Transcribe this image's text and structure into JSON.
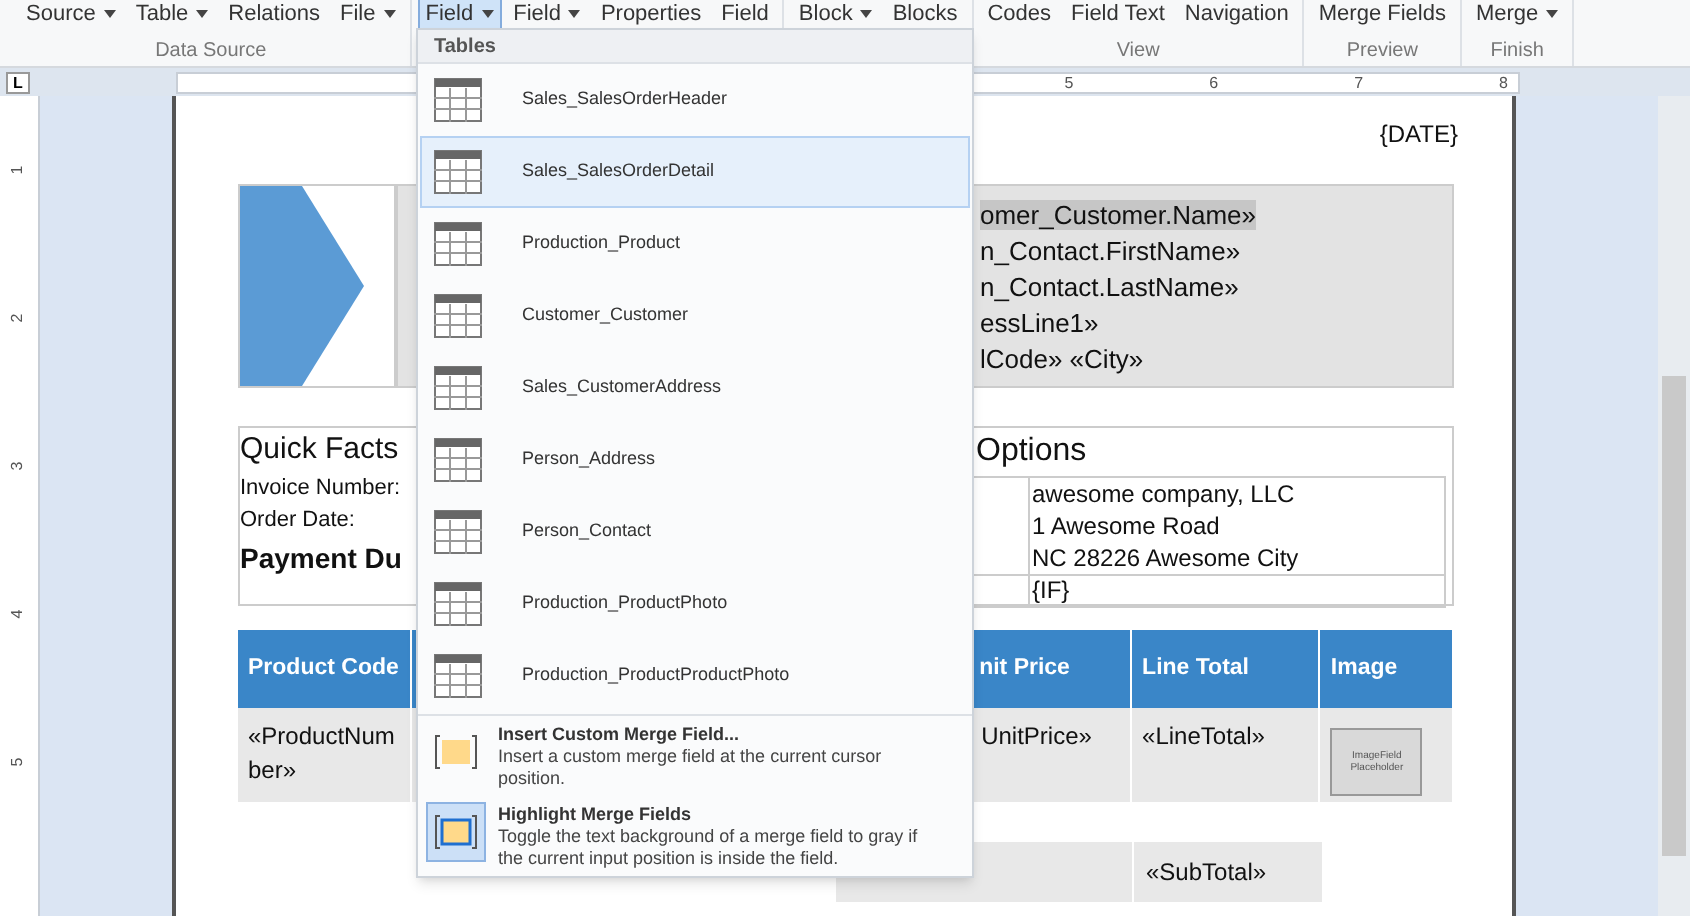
{
  "ribbon": {
    "groups": [
      {
        "label": "Data Source",
        "buttons": [
          {
            "label": "Source",
            "caret": true,
            "selected": false
          },
          {
            "label": "Table",
            "caret": true,
            "selected": false
          },
          {
            "label": "Relations",
            "caret": false,
            "selected": false
          },
          {
            "label": "File",
            "caret": true,
            "selected": false
          }
        ]
      },
      {
        "buttons": [
          {
            "label": "Field",
            "caret": true,
            "selected": true
          },
          {
            "label": "Field",
            "caret": true,
            "selected": false
          },
          {
            "label": "Properties",
            "caret": false,
            "selected": false
          },
          {
            "label": "Field",
            "caret": false,
            "selected": false
          }
        ]
      },
      {
        "buttons": [
          {
            "label": "Block",
            "caret": true,
            "selected": false
          },
          {
            "label": "Blocks",
            "caret": false,
            "selected": false
          }
        ]
      },
      {
        "label": "View",
        "buttons": [
          {
            "label": "Codes",
            "caret": false,
            "selected": false
          },
          {
            "label": "Field Text",
            "caret": false,
            "selected": false
          },
          {
            "label": "Navigation",
            "caret": false,
            "selected": false
          }
        ]
      },
      {
        "label": "Preview",
        "buttons": [
          {
            "label": "Merge Fields",
            "caret": false,
            "selected": false
          }
        ]
      },
      {
        "label": "Finish",
        "buttons": [
          {
            "label": "Merge",
            "caret": true,
            "selected": false
          }
        ]
      }
    ]
  },
  "ruler": {
    "tab_selector": "L",
    "numbers": [
      "5",
      "6",
      "7",
      "8"
    ],
    "vertical_numbers": [
      "1",
      "2",
      "3",
      "4",
      "5"
    ]
  },
  "document": {
    "date": "{DATE}",
    "recipient_lines": [
      {
        "text": "omer_Customer.Name»",
        "highlighted": true
      },
      {
        "text": "n_Contact.FirstName»",
        "highlighted": false
      },
      {
        "text": "n_Contact.LastName»",
        "highlighted": false
      },
      {
        "text": "essLine1»",
        "highlighted": false
      },
      {
        "text": "lCode» «City»",
        "highlighted": false
      }
    ],
    "quick_facts": {
      "title": "Quick Facts",
      "rows": [
        "Invoice Number:",
        "Order Date:"
      ],
      "subtitle": "Payment Du"
    },
    "options": {
      "title": "Options",
      "lines": [
        "awesome company, LLC",
        "1 Awesome Road",
        "NC 28226 Awesome City"
      ],
      "condition": "{IF}"
    },
    "product_table": {
      "columns": [
        "Product Code",
        "nit Price",
        "Line Total",
        "Image"
      ],
      "row": {
        "product_number": "«ProductNumber»",
        "unit_price": "UnitPrice»",
        "line_total": "«LineTotal»",
        "image": "ImageField Placeholder"
      }
    },
    "subtotal": "«SubTotal»"
  },
  "dropdown": {
    "header": "Tables",
    "tables": [
      {
        "label": "Sales_SalesOrderHeader",
        "selected": false
      },
      {
        "label": "Sales_SalesOrderDetail",
        "selected": true
      },
      {
        "label": "Production_Product",
        "selected": false
      },
      {
        "label": "Customer_Customer",
        "selected": false
      },
      {
        "label": "Sales_CustomerAddress",
        "selected": false
      },
      {
        "label": "Person_Address",
        "selected": false
      },
      {
        "label": "Person_Contact",
        "selected": false
      },
      {
        "label": "Production_ProductPhoto",
        "selected": false
      },
      {
        "label": "Production_ProductProductPhoto",
        "selected": false
      }
    ],
    "commands": [
      {
        "kind": "insert",
        "title": "Insert Custom Merge Field...",
        "description": "Insert a custom merge field at the current cursor position.",
        "on": false
      },
      {
        "kind": "toggle",
        "title": "Highlight Merge Fields",
        "description": "Toggle the text background of a merge field to gray if the current input position is inside the field.",
        "on": true
      }
    ]
  }
}
